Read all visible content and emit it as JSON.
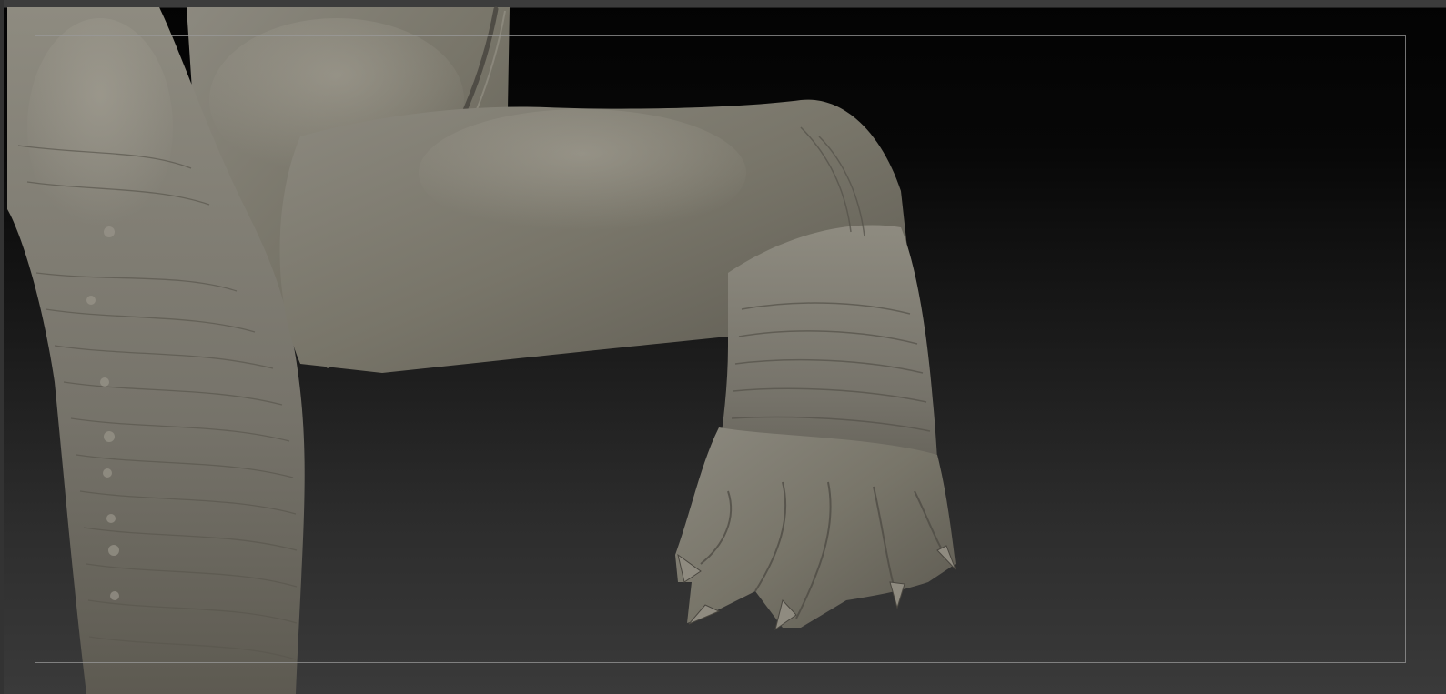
{
  "app": {
    "view": "3d-viewport",
    "subject": "sculpted-creature-leg"
  },
  "colors": {
    "background_top": "#030303",
    "background_bottom": "#3a3a3a",
    "clay": "#7d7a70",
    "clay_dark": "#4f4c45",
    "clay_light": "#a19d92",
    "frame": "#9a9a9a"
  }
}
